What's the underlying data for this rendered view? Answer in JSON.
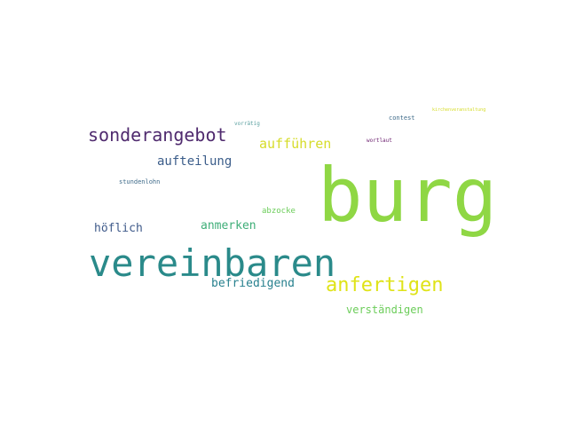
{
  "words": [
    {
      "text": "burg",
      "color": "#8fd744"
    },
    {
      "text": "vereinbaren",
      "color": "#2a8a8a"
    },
    {
      "text": "sonderangebot",
      "color": "#4f2a6e"
    },
    {
      "text": "anfertigen",
      "color": "#dfe318"
    },
    {
      "text": "aufführen",
      "color": "#d6dc2a"
    },
    {
      "text": "aufteilung",
      "color": "#3b5d8a"
    },
    {
      "text": "anmerken",
      "color": "#3fae78"
    },
    {
      "text": "höflich",
      "color": "#3f5a8a"
    },
    {
      "text": "befriedigend",
      "color": "#27808e"
    },
    {
      "text": "verständigen",
      "color": "#6ccd5a"
    },
    {
      "text": "abzocke",
      "color": "#6ccd5a"
    },
    {
      "text": "stundenlohn",
      "color": "#3f6b8a"
    },
    {
      "text": "vorrätig",
      "color": "#5aa0a0"
    },
    {
      "text": "contest",
      "color": "#3f6b8a"
    },
    {
      "text": "wortlaut",
      "color": "#6b1f6e"
    },
    {
      "text": "kirchenveranstaltung",
      "color": "#d6dc2a"
    }
  ]
}
